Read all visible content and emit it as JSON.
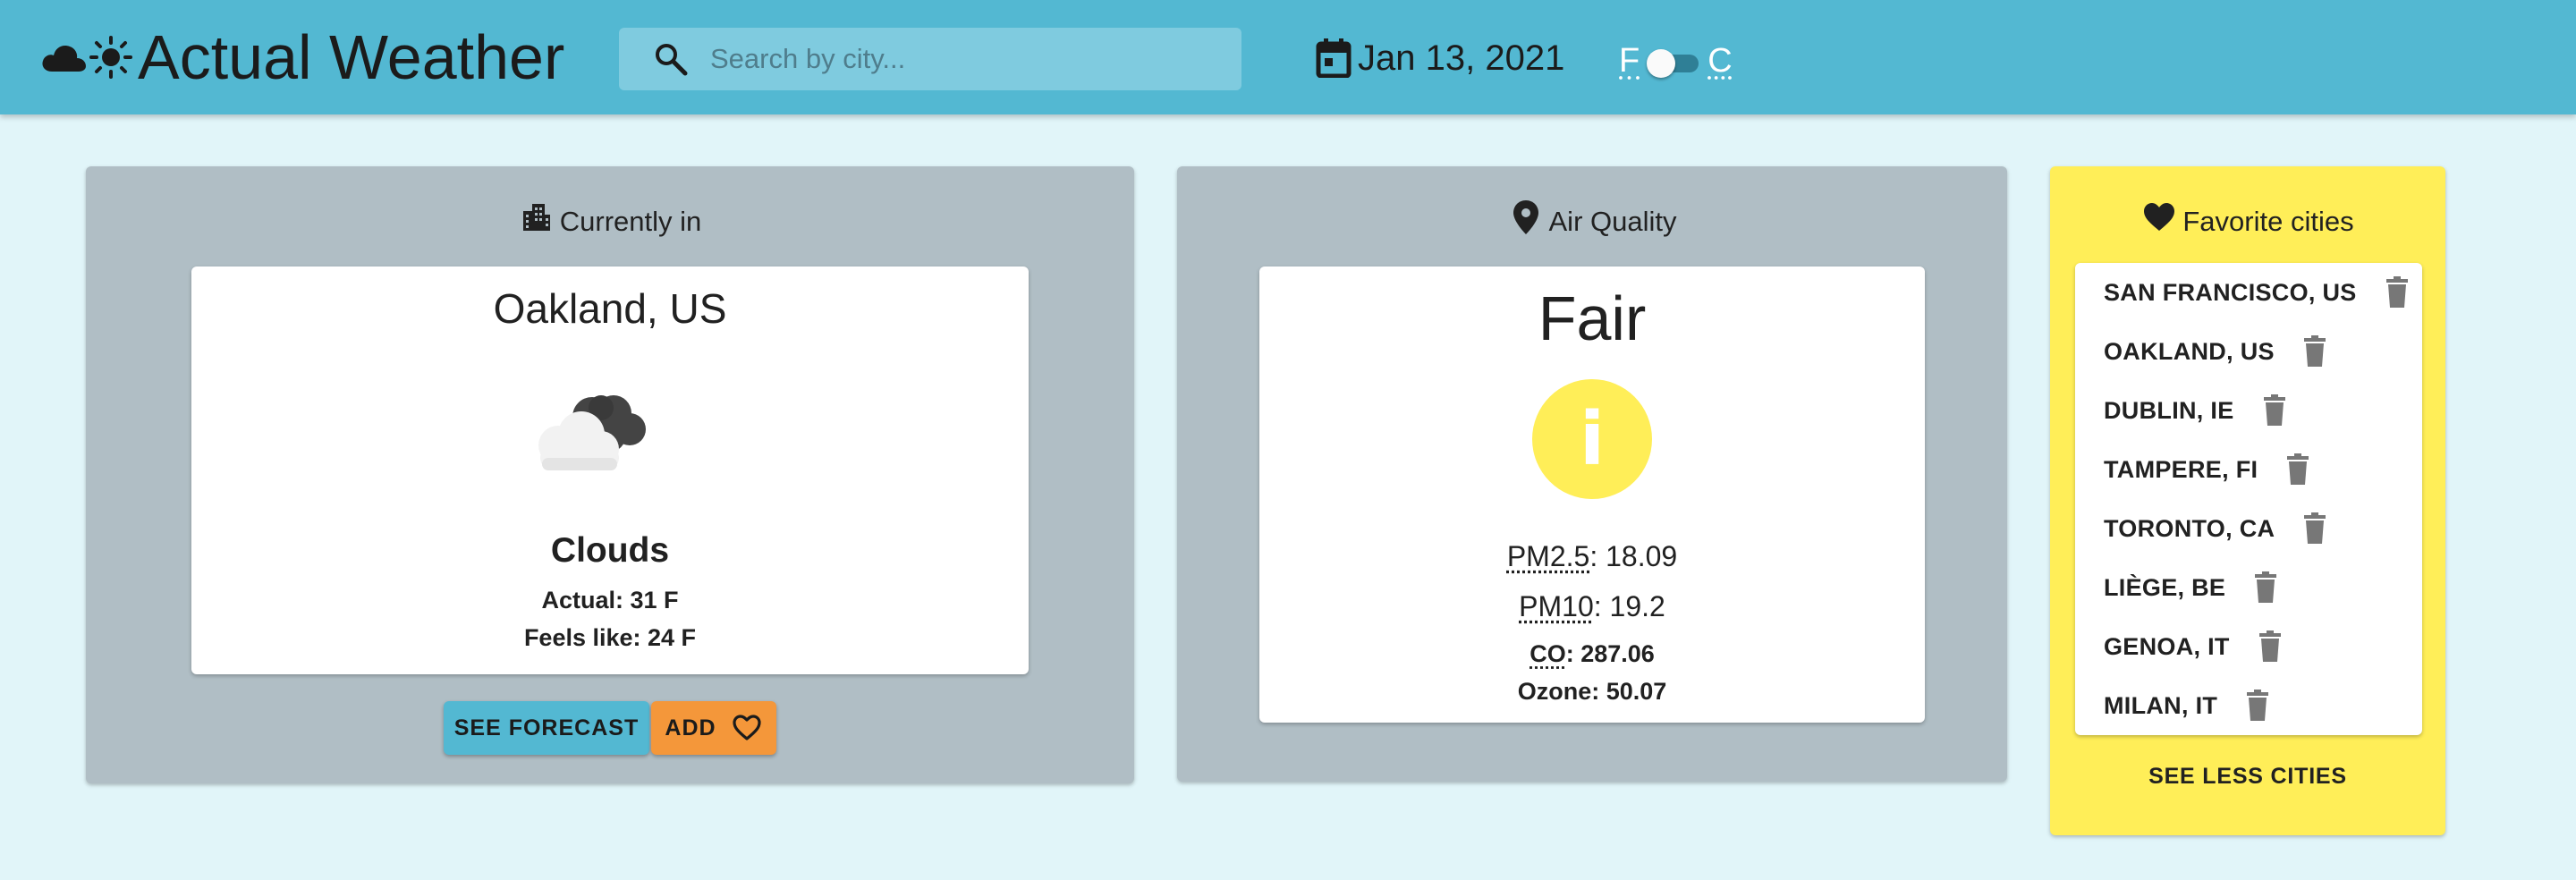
{
  "header": {
    "title": "Actual Weather",
    "logo_icons": [
      "cloud-icon",
      "sun-icon"
    ],
    "search_placeholder": "Search by city...",
    "search_value": "",
    "date": "Jan 13, 2021",
    "unit_left": "F",
    "unit_right": "C",
    "unit_selected": "F",
    "colors": {
      "appbar": "#53b8d2",
      "search_bg": "#7fcbdf"
    }
  },
  "current": {
    "title": "Currently in",
    "title_icon": "city-icon",
    "city": "Oakland, US",
    "weather_icon": "clouds-icon",
    "condition": "Clouds",
    "actual": "Actual: 31 F",
    "feels": "Feels like: 24 F",
    "forecast_label": "SEE FORECAST",
    "add_label": "ADD",
    "add_icon": "heart-outline-icon",
    "colors": {
      "forecast_btn": "#53b8d2",
      "add_btn": "#f4973a"
    }
  },
  "air": {
    "title": "Air Quality",
    "title_icon": "location-pin-icon",
    "level": "Fair",
    "badge_icon": "info-icon",
    "badge_color": "#ffee58",
    "pm25_label": "PM2.5",
    "pm25_value": ": 18.09",
    "pm10_label": "PM10",
    "pm10_value": ": 19.2",
    "co_label": "CO",
    "co_value": ": 287.06",
    "ozone": "Ozone: 50.07"
  },
  "favorites": {
    "title": "Favorite cities",
    "title_icon": "heart-icon",
    "items": [
      {
        "name": "SAN FRANCISCO, US"
      },
      {
        "name": "OAKLAND, US"
      },
      {
        "name": "DUBLIN, IE"
      },
      {
        "name": "TAMPERE, FI"
      },
      {
        "name": "TORONTO, CA"
      },
      {
        "name": "LIÈGE, BE"
      },
      {
        "name": "GENOA, IT"
      },
      {
        "name": "MILAN, IT"
      }
    ],
    "delete_icon": "trash-icon",
    "less_label": "SEE LESS CITIES",
    "panel_color": "#ffee58"
  }
}
